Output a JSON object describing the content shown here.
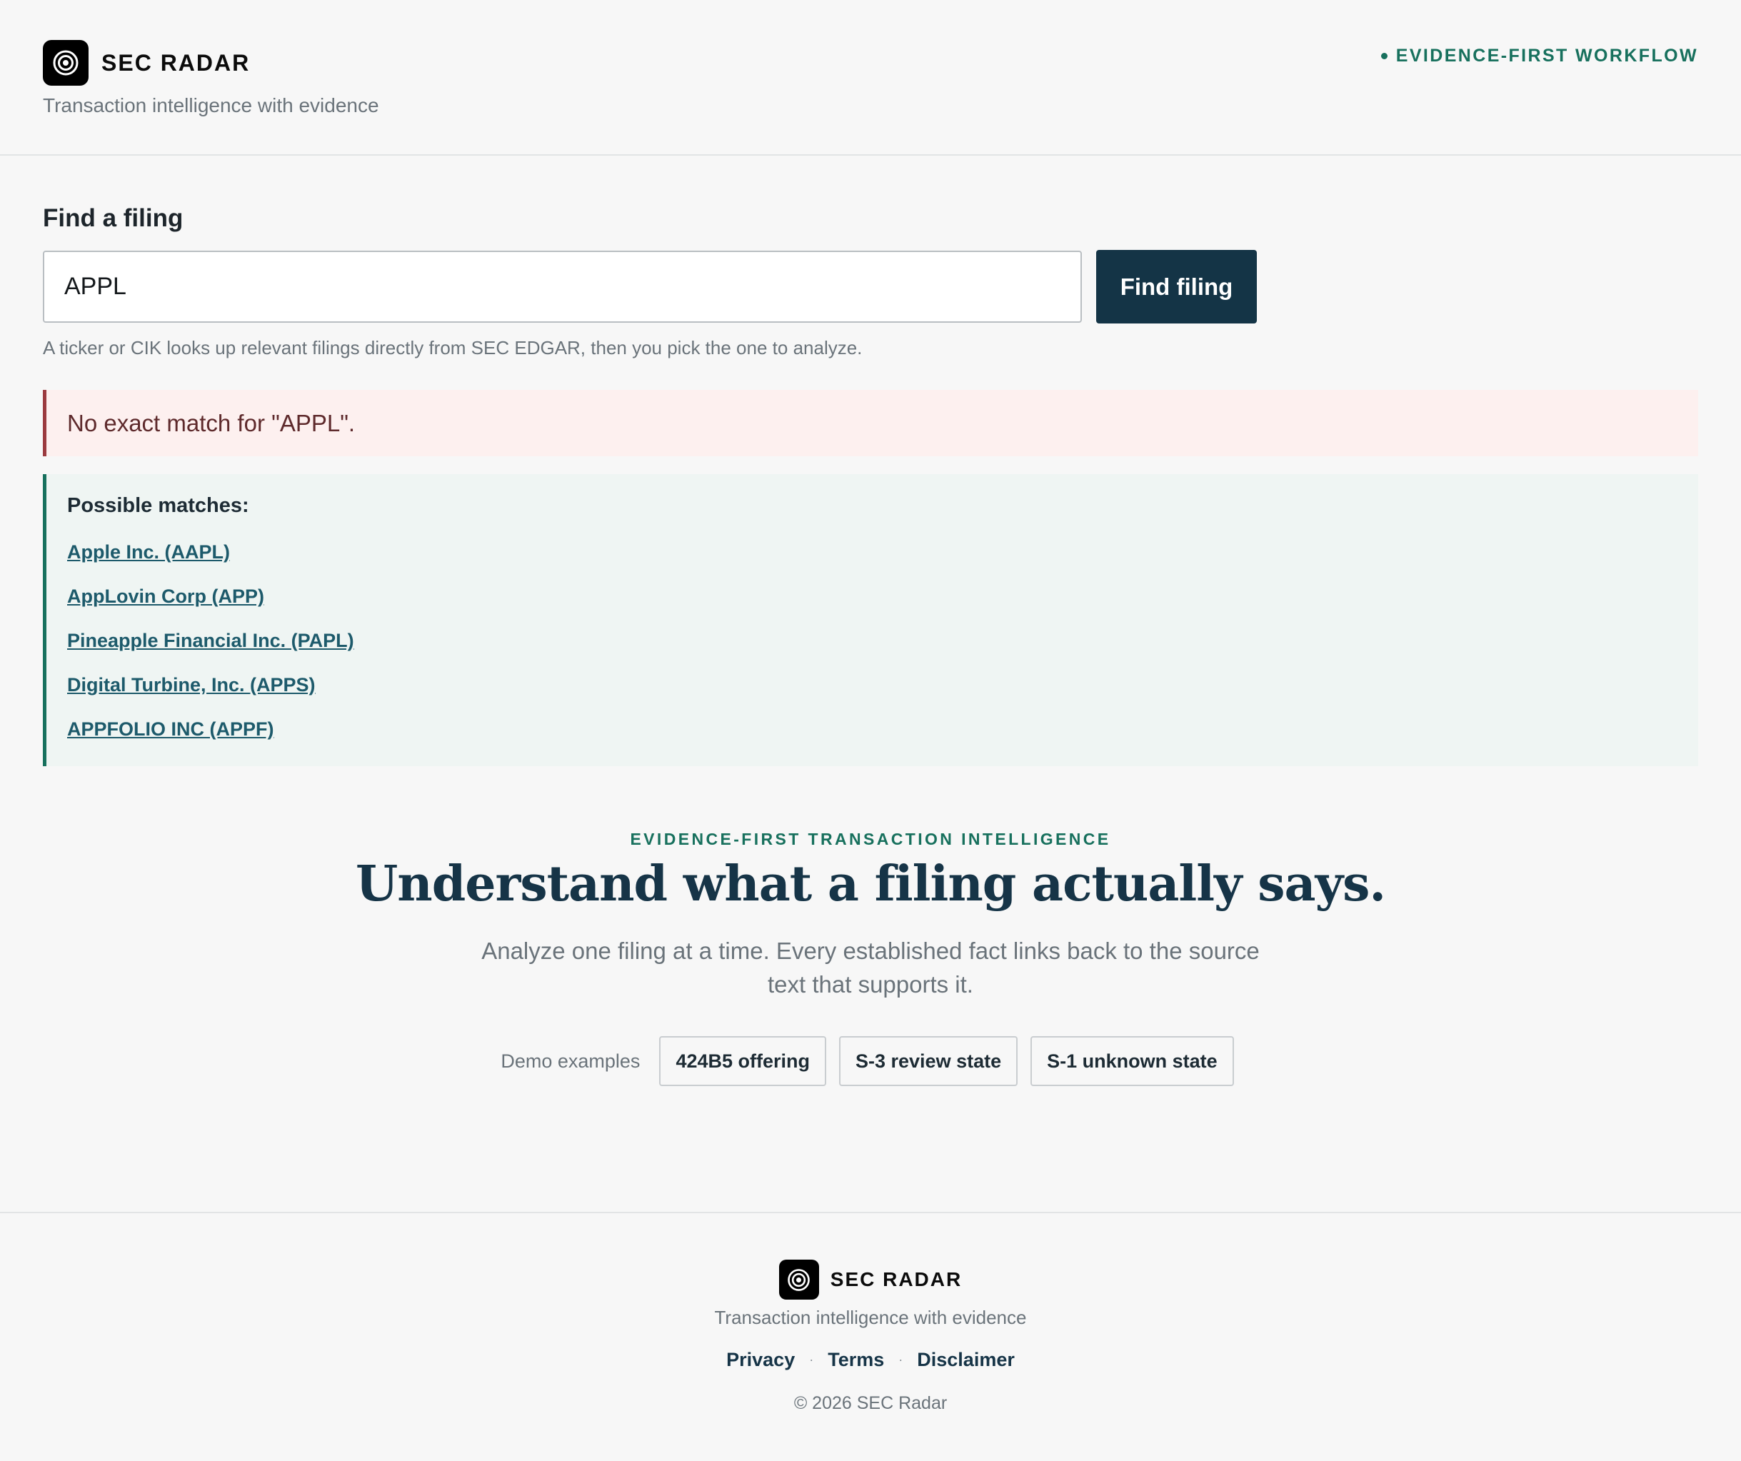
{
  "header": {
    "brand_name": "SEC RADAR",
    "tagline": "Transaction intelligence with evidence",
    "workflow_badge": "EVIDENCE-FIRST WORKFLOW"
  },
  "search": {
    "label": "Find a filing",
    "value": "APPL",
    "button_label": "Find filing",
    "helper_text": "A ticker or CIK looks up relevant filings directly from SEC EDGAR, then you pick the one to analyze."
  },
  "error": {
    "message": "No exact match for \"APPL\"."
  },
  "matches": {
    "title": "Possible matches:",
    "items": [
      {
        "label": "Apple Inc. (AAPL)"
      },
      {
        "label": "AppLovin Corp (APP)"
      },
      {
        "label": "Pineapple Financial Inc. (PAPL)"
      },
      {
        "label": "Digital Turbine, Inc. (APPS)"
      },
      {
        "label": "APPFOLIO INC (APPF)"
      }
    ]
  },
  "hero": {
    "eyebrow": "EVIDENCE-FIRST TRANSACTION INTELLIGENCE",
    "title": "Understand what a filing actually says.",
    "subtitle": "Analyze one filing at a time. Every established fact links back to the source text that supports it.",
    "demo_label": "Demo examples",
    "demos": [
      {
        "label": "424B5 offering"
      },
      {
        "label": "S-3 review state"
      },
      {
        "label": "S-1 unknown state"
      }
    ]
  },
  "footer": {
    "brand_name": "SEC RADAR",
    "tagline": "Transaction intelligence with evidence",
    "links": [
      {
        "label": "Privacy"
      },
      {
        "label": "Terms"
      },
      {
        "label": "Disclaimer"
      }
    ],
    "separator": "·",
    "copyright": "© 2026 SEC Radar"
  },
  "colors": {
    "accent_green": "#17705d",
    "navy": "#143446",
    "link": "#1d5a6b",
    "error_border": "#9b3a3f",
    "background": "#f7f7f7"
  },
  "icons": {
    "logo": "radar-target-icon",
    "status_dot": "status-dot-icon"
  }
}
